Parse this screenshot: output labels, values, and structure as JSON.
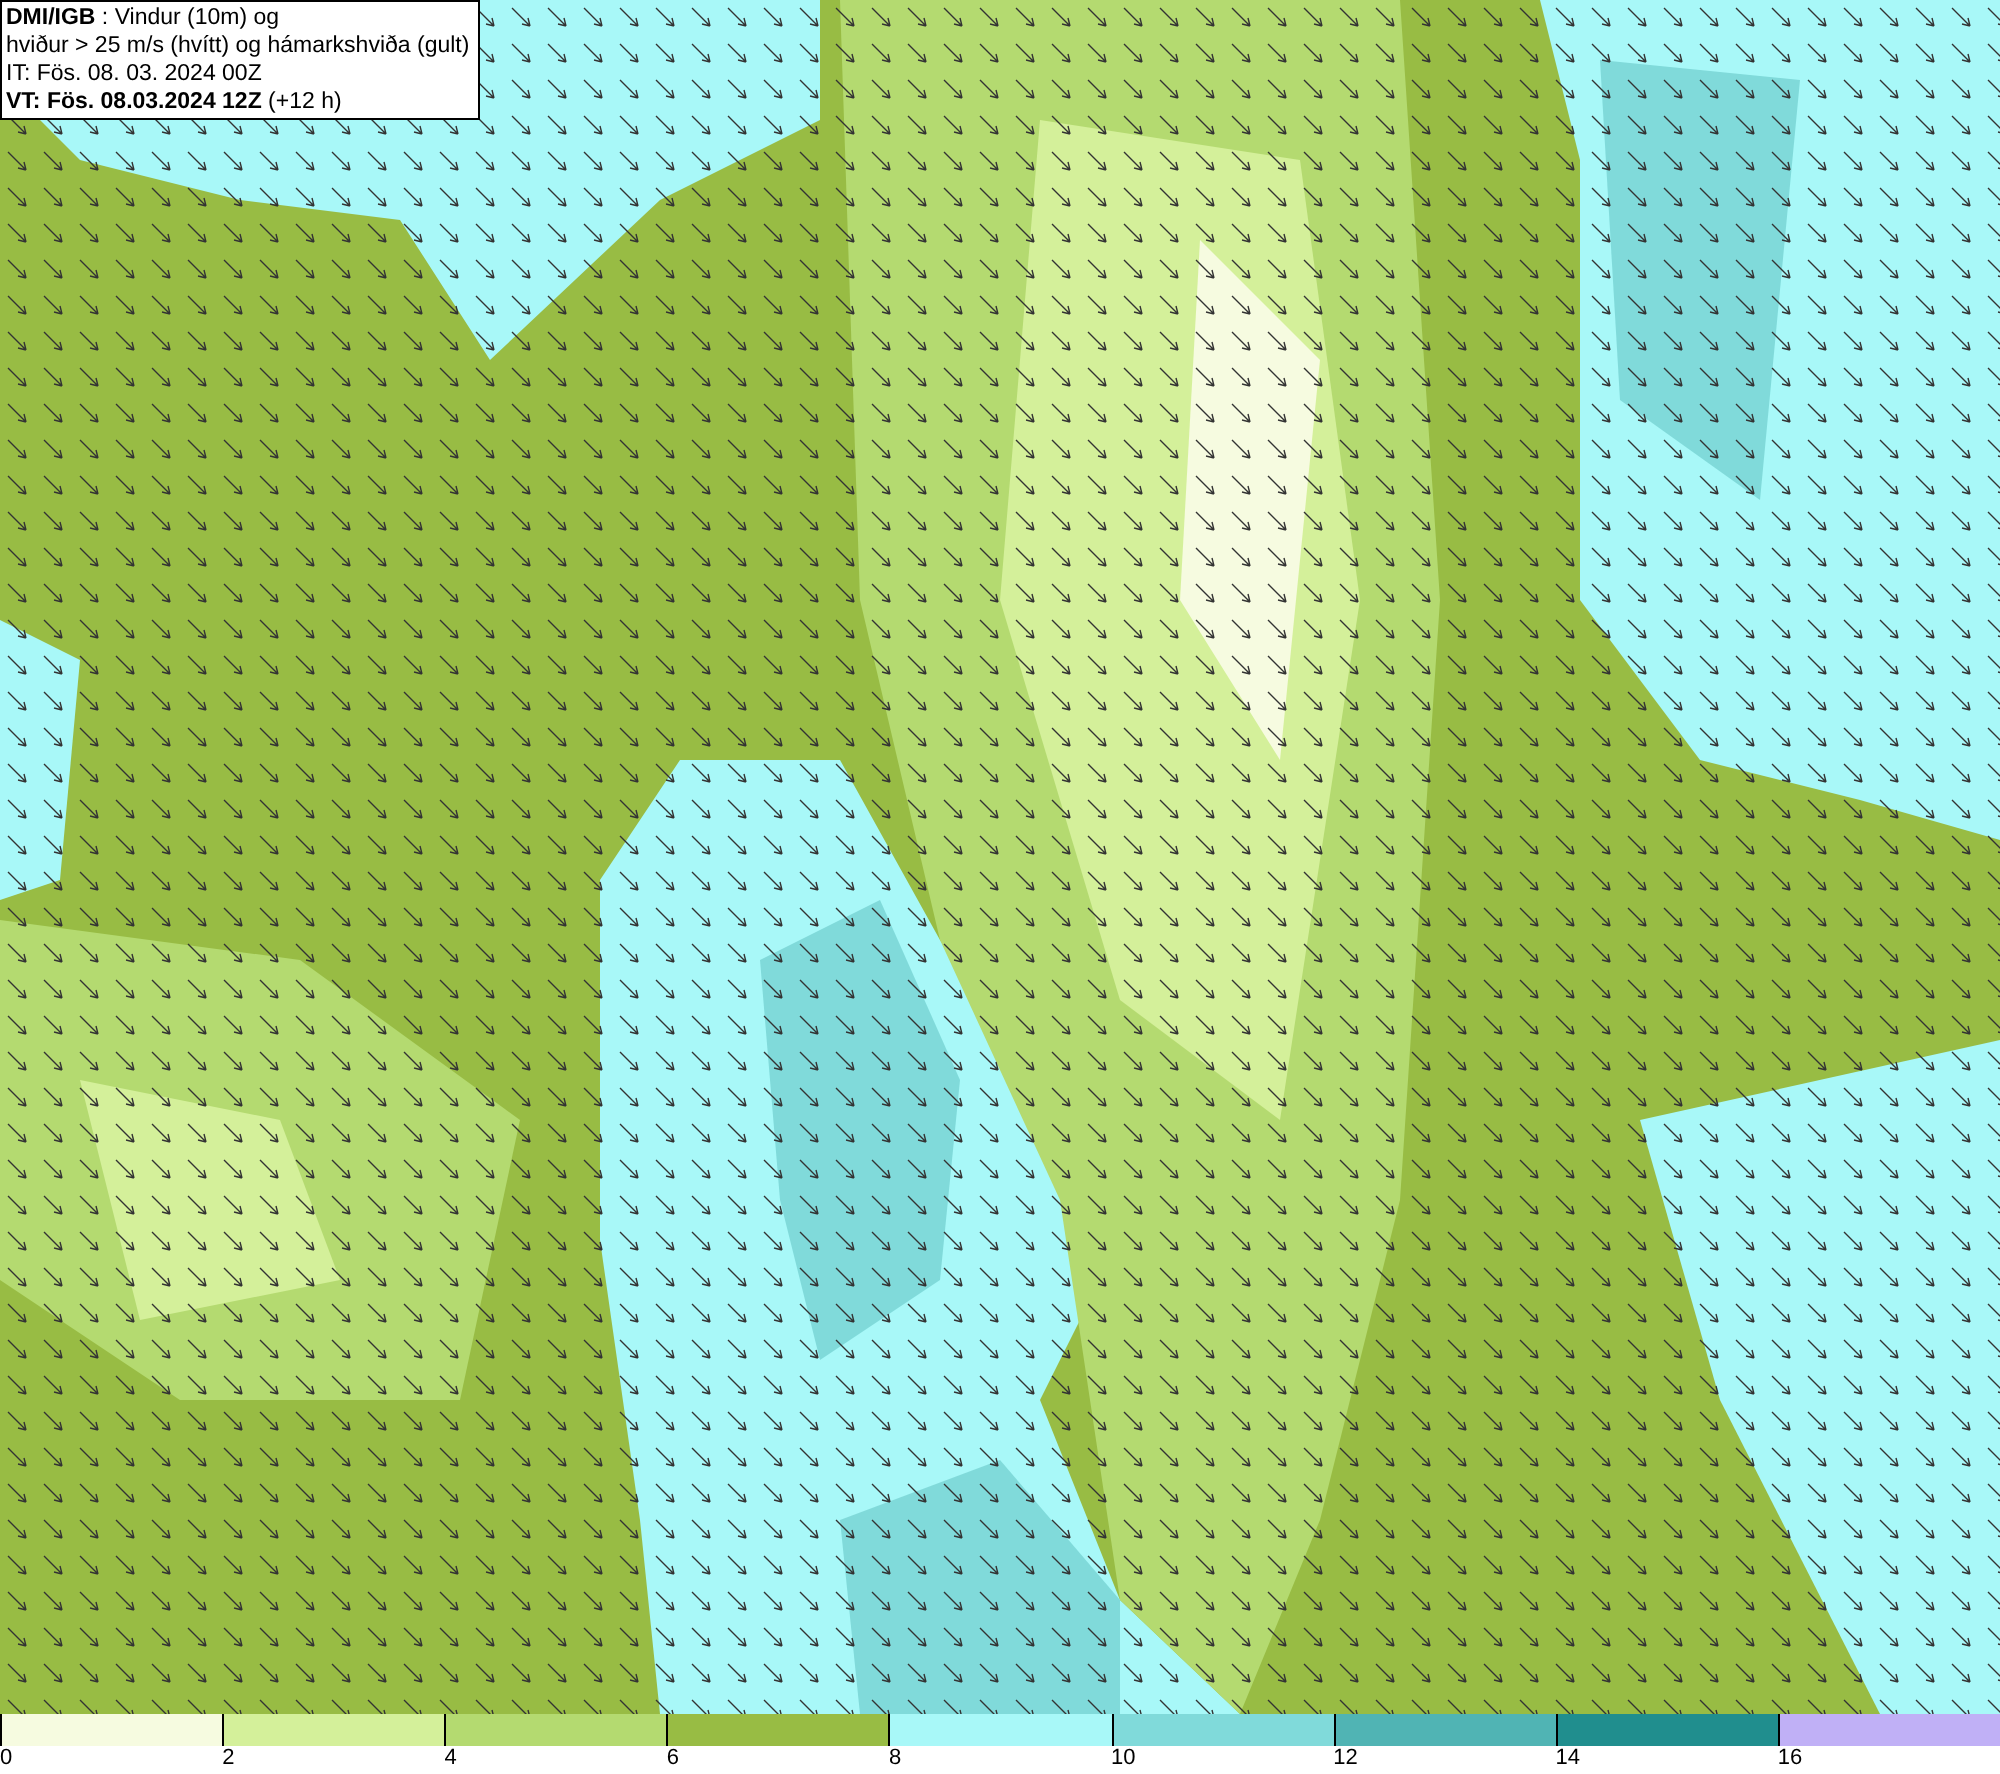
{
  "title_box": {
    "lines": [
      "**DMI/IGB** : Vindur (10m) og",
      "hviður > 25 m/s (hvítt) og hámarkshviða (gult)",
      "IT: Fös. 08. 03. 2024 00Z",
      "**VT: Fös. 08.03.2024 12Z** (+12 h)"
    ]
  },
  "legend": {
    "items": [
      {
        "label": "0",
        "color": "#f6fbe0"
      },
      {
        "label": "2",
        "color": "#d4f09a"
      },
      {
        "label": "4",
        "color": "#b4da70"
      },
      {
        "label": "6",
        "color": "#98bc44"
      },
      {
        "label": "8",
        "color": "#a8f8f8"
      },
      {
        "label": "10",
        "color": "#80dada"
      },
      {
        "label": "12",
        "color": "#50b4b4"
      },
      {
        "label": "14",
        "color": "#208e8e"
      },
      {
        "label": "16",
        "color": "#c0b0f6"
      }
    ]
  }
}
